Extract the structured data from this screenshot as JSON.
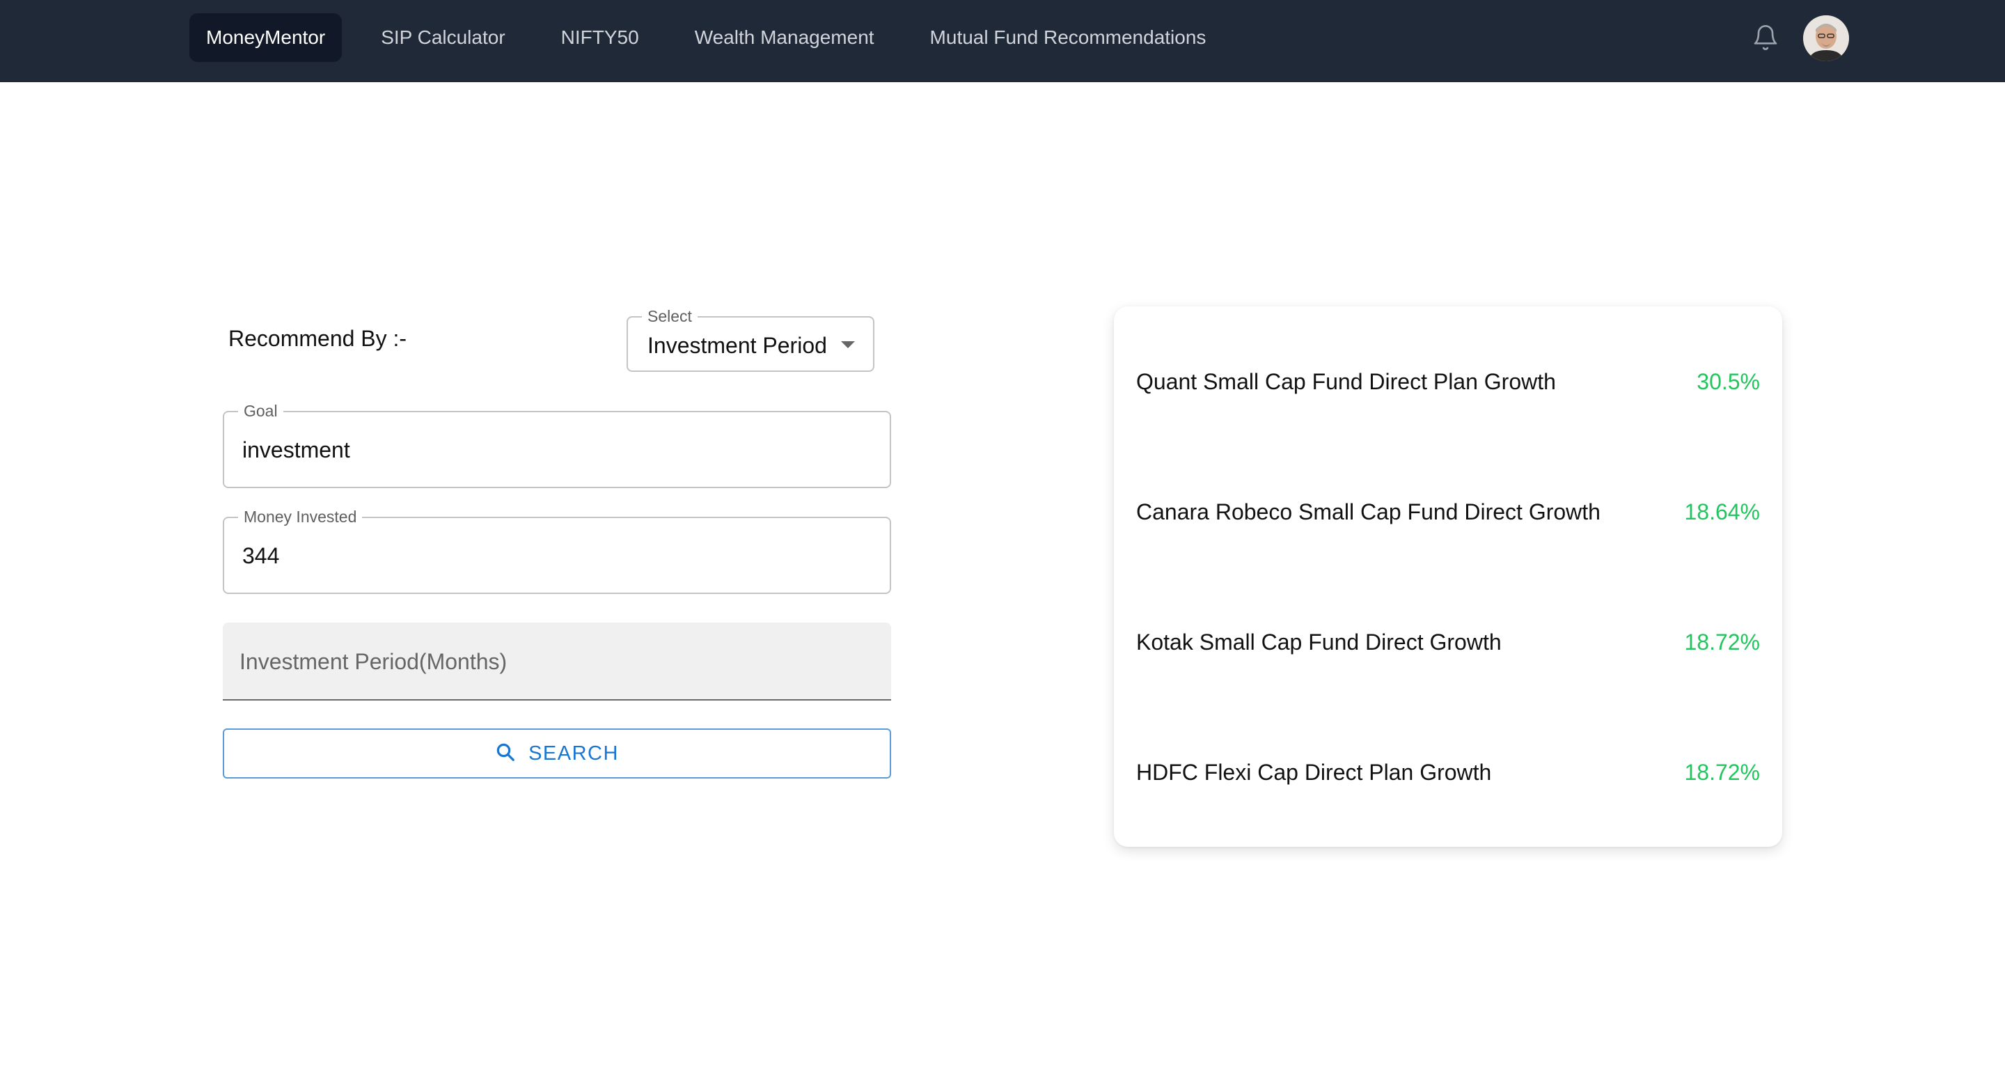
{
  "navbar": {
    "items": [
      {
        "label": "MoneyMentor",
        "active": true
      },
      {
        "label": "SIP Calculator",
        "active": false
      },
      {
        "label": "NIFTY50",
        "active": false
      },
      {
        "label": "Wealth Management",
        "active": false
      },
      {
        "label": "Mutual Fund Recommendations",
        "active": false
      }
    ],
    "icons": [
      "bell-icon",
      "avatar"
    ]
  },
  "form": {
    "recommend_label": "Recommend By :-",
    "select": {
      "label": "Select",
      "value": "Investment Period"
    },
    "goal": {
      "label": "Goal",
      "value": "investment"
    },
    "money_invested": {
      "label": "Money Invested",
      "value": "344"
    },
    "investment_period": {
      "placeholder": "Investment Period(Months)",
      "value": ""
    },
    "search_button": {
      "label": "SEARCH",
      "icon": "search-icon"
    }
  },
  "results": {
    "funds": [
      {
        "name": "Quant Small Cap Fund Direct Plan Growth",
        "return": "30.5%"
      },
      {
        "name": "Canara Robeco Small Cap Fund Direct Growth",
        "return": "18.64%"
      },
      {
        "name": "Kotak Small Cap Fund Direct Growth",
        "return": "18.72%"
      },
      {
        "name": "HDFC Flexi Cap Direct Plan Growth",
        "return": "18.72%"
      }
    ]
  },
  "colors": {
    "navbar_bg": "#1f2937",
    "nav_active_bg": "#111827",
    "accent_blue": "#1976d2",
    "return_green": "#22c55e"
  }
}
